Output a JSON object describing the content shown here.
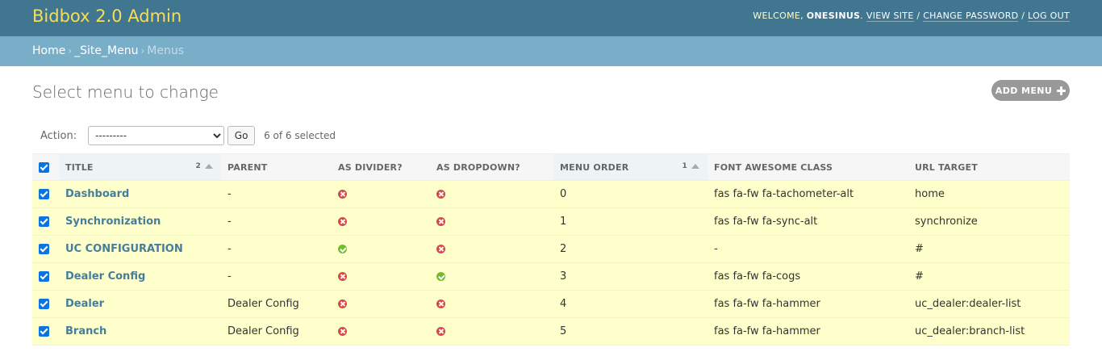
{
  "header": {
    "brand": "Bidbox 2.0 Admin",
    "welcome": "WELCOME,",
    "username": "ONESINUS",
    "view_site": "VIEW SITE",
    "change_password": "CHANGE PASSWORD",
    "log_out": "LOG OUT"
  },
  "breadcrumbs": {
    "home": "Home",
    "app": "_Site_Menu",
    "current": "Menus"
  },
  "page": {
    "title": "Select menu to change",
    "add_button": "ADD MENU"
  },
  "actions": {
    "label": "Action:",
    "selected_option": "---------",
    "go": "Go",
    "counter": "6 of 6 selected"
  },
  "table": {
    "columns": {
      "title": "TITLE",
      "title_sort_priority": "2",
      "parent": "PARENT",
      "as_divider": "AS DIVIDER?",
      "as_dropdown": "AS DROPDOWN?",
      "menu_order": "MENU ORDER",
      "menu_order_sort_priority": "1",
      "font_awesome": "FONT AWESOME CLASS",
      "url_target": "URL TARGET"
    },
    "rows": [
      {
        "title": "Dashboard",
        "parent": "-",
        "as_divider": false,
        "as_dropdown": false,
        "menu_order": "0",
        "font_awesome": "fas fa-fw fa-tachometer-alt",
        "url_target": "home"
      },
      {
        "title": "Synchronization",
        "parent": "-",
        "as_divider": false,
        "as_dropdown": false,
        "menu_order": "1",
        "font_awesome": "fas fa-fw fa-sync-alt",
        "url_target": "synchronize"
      },
      {
        "title": "UC CONFIGURATION",
        "parent": "-",
        "as_divider": true,
        "as_dropdown": false,
        "menu_order": "2",
        "font_awesome": "-",
        "url_target": "#"
      },
      {
        "title": "Dealer Config",
        "parent": "-",
        "as_divider": false,
        "as_dropdown": true,
        "menu_order": "3",
        "font_awesome": "fas fa-fw fa-cogs",
        "url_target": "#"
      },
      {
        "title": "Dealer",
        "parent": "Dealer Config",
        "as_divider": false,
        "as_dropdown": false,
        "menu_order": "4",
        "font_awesome": "fas fa-fw fa-hammer",
        "url_target": "uc_dealer:dealer-list"
      },
      {
        "title": "Branch",
        "parent": "Dealer Config",
        "as_divider": false,
        "as_dropdown": false,
        "menu_order": "5",
        "font_awesome": "fas fa-fw fa-hammer",
        "url_target": "uc_dealer:branch-list"
      }
    ]
  },
  "colors": {
    "header_bg": "#417690",
    "breadcrumb_bg": "#79aec8",
    "brand_text": "#f5dd5d",
    "selected_row_bg": "#ffffcc",
    "link": "#447e9b",
    "yes_icon": "#70bf2b",
    "no_icon": "#dd4646"
  },
  "icons": {
    "yes": "check-circle-icon",
    "no": "x-circle-icon",
    "add": "plus-icon",
    "sort": "sort-ascending-icon"
  }
}
